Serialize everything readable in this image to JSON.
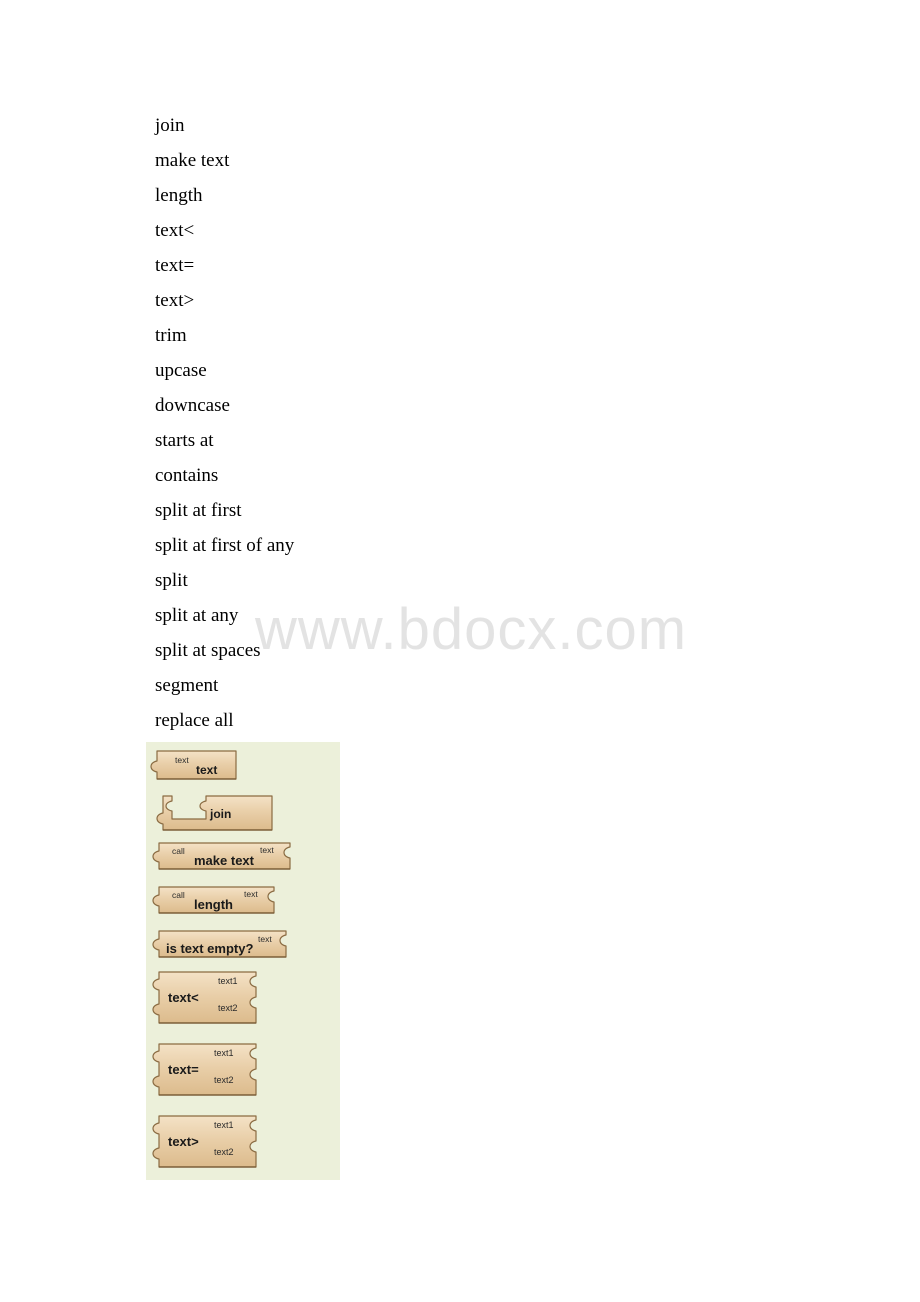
{
  "document": {
    "watermark": "www.bdocx.com"
  },
  "term_list": {
    "items": [
      {
        "label": "join"
      },
      {
        "label": "make text"
      },
      {
        "label": "length"
      },
      {
        "label": "text<"
      },
      {
        "label": "text="
      },
      {
        "label": "text>"
      },
      {
        "label": "trim"
      },
      {
        "label": "upcase"
      },
      {
        "label": "downcase"
      },
      {
        "label": "starts at"
      },
      {
        "label": "contains"
      },
      {
        "label": "split at first"
      },
      {
        "label": "split at first of any"
      },
      {
        "label": "split"
      },
      {
        "label": "split at any"
      },
      {
        "label": "split at spaces"
      },
      {
        "label": "segment"
      },
      {
        "label": "replace all"
      }
    ]
  },
  "blocks_panel": {
    "background_color": "#ecf0da",
    "block_fill_color": "#e9cfa9",
    "block_border_color": "#8a6b42",
    "blocks": [
      {
        "id": "text",
        "prefix": "",
        "label": "text",
        "arg_top": "text",
        "args": []
      },
      {
        "id": "join",
        "prefix": "",
        "label": "join",
        "args": []
      },
      {
        "id": "make-text",
        "prefix": "call",
        "label": "make text",
        "args": [
          "text"
        ]
      },
      {
        "id": "length",
        "prefix": "call",
        "label": "length",
        "args": [
          "text"
        ]
      },
      {
        "id": "is-text-empty",
        "prefix": "",
        "label": "is text empty?",
        "args": [
          "text"
        ]
      },
      {
        "id": "text-less-than",
        "prefix": "",
        "label": "text<",
        "args": [
          "text1",
          "text2"
        ]
      },
      {
        "id": "text-equals",
        "prefix": "",
        "label": "text=",
        "args": [
          "text1",
          "text2"
        ]
      },
      {
        "id": "text-greater-than",
        "prefix": "",
        "label": "text>",
        "args": [
          "text1",
          "text2"
        ]
      }
    ]
  }
}
